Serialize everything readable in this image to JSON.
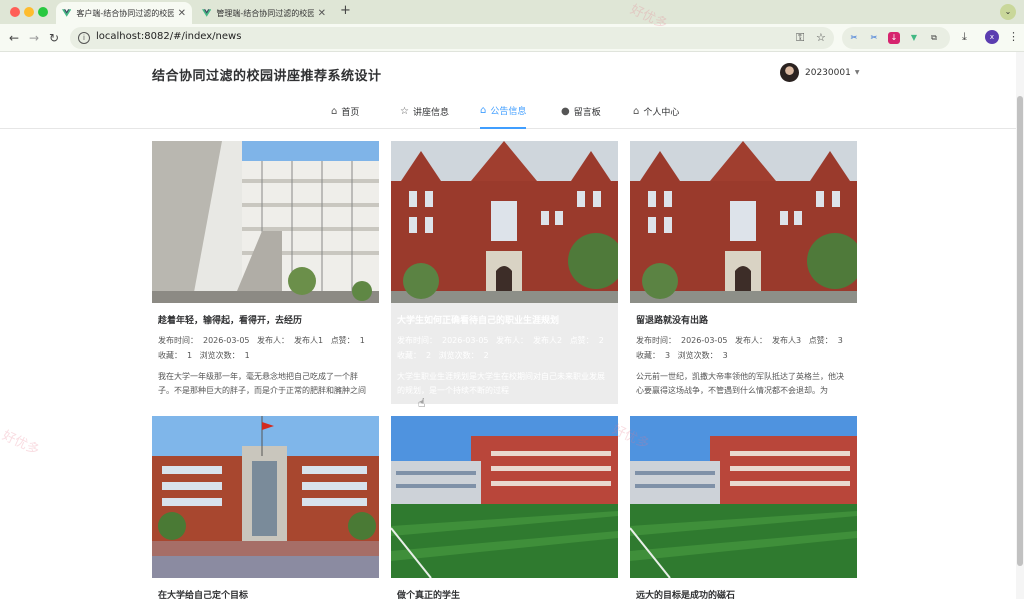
{
  "browser": {
    "tabs": [
      {
        "title": "客户端-结合协同过滤的校园讲座推荐系统设计",
        "active": true
      },
      {
        "title": "管理端-结合协同过滤的校园讲座推荐系统设计",
        "active": false
      }
    ],
    "url": "localhost:8082/#/index/news",
    "profile_initial": "x"
  },
  "site": {
    "title": "结合协同过滤的校园讲座推荐系统设计",
    "username": "20230001"
  },
  "menu": [
    {
      "label": "首页",
      "icon": "home-icon",
      "active": false
    },
    {
      "label": "讲座信息",
      "icon": "star-icon",
      "active": false
    },
    {
      "label": "公告信息",
      "icon": "bag-icon",
      "active": true
    },
    {
      "label": "留言板",
      "icon": "info-icon",
      "active": false
    },
    {
      "label": "个人中心",
      "icon": "house-icon",
      "active": false
    }
  ],
  "cards": [
    {
      "title": "趁着年轻，输得起，看得开，去经历",
      "time_label": "发布时间：",
      "time": "2026-03-05",
      "publisher_label": "发布人：",
      "publisher": "发布人1",
      "likes_label": "点赞：",
      "likes": "1",
      "favorites_label": "收藏：",
      "favorites": "1",
      "views_label": "浏览次数：",
      "views": "1",
      "desc": "我在大学一年级那一年，毫无悬念地把自己吃成了一个胖子。不是那种巨大的胖子，而是介于正常的肥胖和臃肿之间"
    },
    {
      "title": "大学生如何正确看待自己的职业生涯规划",
      "time_label": "发布时间：",
      "time": "2026-03-05",
      "publisher_label": "发布人：",
      "publisher": "发布人2",
      "likes_label": "点赞：",
      "likes": "2",
      "favorites_label": "收藏：",
      "favorites": "2",
      "views_label": "浏览次数：",
      "views": "2",
      "desc": "大学生职业生涯规划是大学生在校期间对自己未来职业发展的规划，是一个持续不断的过程"
    },
    {
      "title": "留退路就没有出路",
      "time_label": "发布时间：",
      "time": "2026-03-05",
      "publisher_label": "发布人：",
      "publisher": "发布人3",
      "likes_label": "点赞：",
      "likes": "3",
      "favorites_label": "收藏：",
      "favorites": "3",
      "views_label": "浏览次数：",
      "views": "3",
      "desc": "公元前一世纪，凯撒大帝率领他的军队抵达了英格兰，他决心要赢得这场战争，不管遇到什么情况都不会退却。为"
    },
    {
      "title": "在大学给自己定个目标"
    },
    {
      "title": "做个真正的学生"
    },
    {
      "title": "远大的目标是成功的磁石"
    }
  ],
  "watermark": "好优多",
  "colors": {
    "accent": "#409eff",
    "tabbar": "#dfe6d6"
  }
}
